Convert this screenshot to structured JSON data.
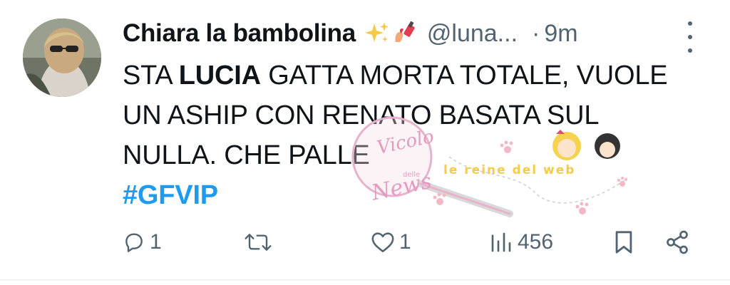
{
  "tweet": {
    "display_name": "Chiara la bambolina",
    "emojis": [
      "sparkles-emoji",
      "nail-polish-emoji"
    ],
    "handle": "@luna...",
    "separator": "·",
    "time": "9m",
    "text": {
      "line1_a": "STA ",
      "line1_bold": "LUCIA",
      "line1_b": " GATTA MORTA TOTALE, VUOLE",
      "line2": "UN ASHIP CON RENATO BASATA SUL",
      "line3": "NULLA. CHE PALLE"
    },
    "hashtag": "#GFVIP"
  },
  "actions": {
    "reply_count": "1",
    "retweet_count": "",
    "like_count": "1",
    "views_count": "456"
  },
  "watermark": {
    "circle_text_1": "Vicolo",
    "circle_text_2": "delle",
    "circle_text_3": "News",
    "banner_text": "le reine del web"
  },
  "colors": {
    "accent": "#1d9bf0",
    "muted": "#536471",
    "text": "#0f1419",
    "watermark_pink": "#e7a3c4",
    "watermark_yellow": "#f2cc4a"
  }
}
